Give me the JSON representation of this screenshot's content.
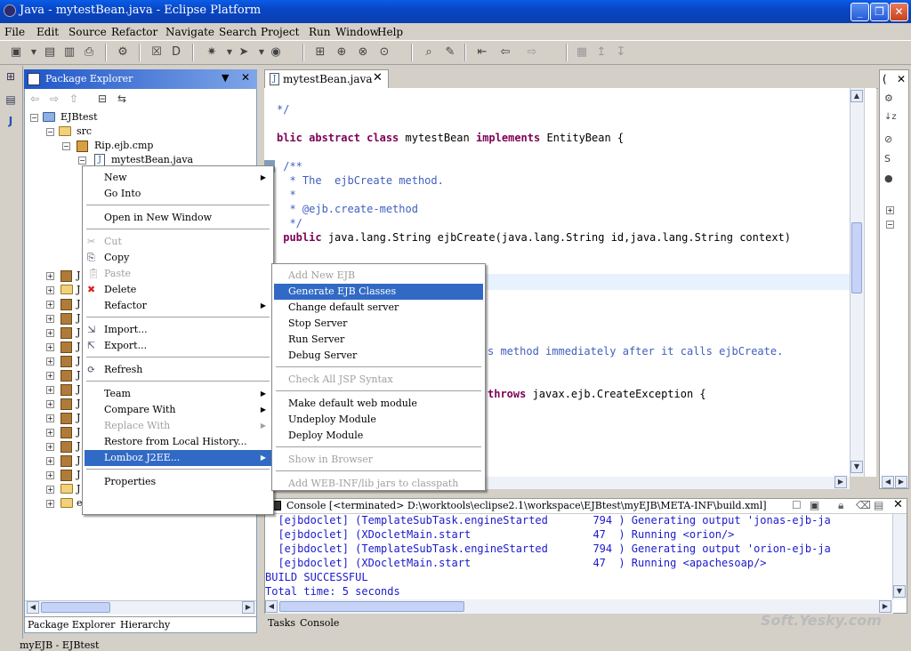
{
  "window": {
    "title": "Java - mytestBean.java - Eclipse Platform"
  },
  "menubar": [
    "File",
    "Edit",
    "Source",
    "Refactor",
    "Navigate",
    "Search",
    "Project",
    "Run",
    "Window",
    "Help"
  ],
  "package_explorer": {
    "title": "Package Explorer",
    "tree": [
      {
        "label": "EJBtest",
        "level": 0
      },
      {
        "label": "src",
        "level": 1
      },
      {
        "label": "Rip.ejb.cmp",
        "level": 2
      },
      {
        "label": "mytestBean.java",
        "level": 3
      }
    ],
    "stub_letters": [
      "J",
      "J",
      "J",
      "J",
      "J",
      "J",
      "J",
      "J",
      "J",
      "J",
      "J",
      "J",
      "J",
      "J",
      "J",
      "J",
      "e"
    ],
    "bottom_tabs": [
      "Package Explorer",
      "Hierarchy"
    ]
  },
  "editor": {
    "tab": "mytestBean.java",
    "lines": [
      {
        "text": "*/",
        "cls": "cm"
      },
      {
        "text": "blic abstract class mytestBean implements EntityBean {",
        "cls": "mixed"
      },
      {
        "text": " /**",
        "cls": "cm"
      },
      {
        "text": "  * The  ejbCreate method.",
        "cls": "cm"
      },
      {
        "text": "  *",
        "cls": "cm"
      },
      {
        "text": "  * @ejb.create-method",
        "cls": "cm"
      },
      {
        "text": "  */",
        "cls": "cm"
      },
      {
        "text": " public java.lang.String ejbCreate(java.lang.String id,java.lang.String context)",
        "cls": "mixed2"
      }
    ],
    "line_partial_1": "s method immediately after it calls ejbCreate.",
    "line_partial_2_kw": "throws",
    "line_partial_2_rest": " javax.ejb.CreateException {"
  },
  "context_menu": {
    "items": [
      {
        "label": "New",
        "submenu": true
      },
      {
        "label": "Go Into"
      },
      {
        "sep": true
      },
      {
        "label": "Open in New Window"
      },
      {
        "sep": true
      },
      {
        "label": "Cut",
        "disabled": true
      },
      {
        "label": "Copy"
      },
      {
        "label": "Paste",
        "disabled": true
      },
      {
        "label": "Delete"
      },
      {
        "label": "Refactor",
        "submenu": true
      },
      {
        "sep": true
      },
      {
        "label": "Import..."
      },
      {
        "label": "Export..."
      },
      {
        "sep": true
      },
      {
        "label": "Refresh"
      },
      {
        "sep": true
      },
      {
        "label": "Team",
        "submenu": true
      },
      {
        "label": "Compare With",
        "submenu": true
      },
      {
        "label": "Replace With",
        "submenu": true,
        "disabled": true
      },
      {
        "label": "Restore from Local History..."
      },
      {
        "label": "Lomboz J2EE...",
        "submenu": true,
        "selected": true
      },
      {
        "sep": true
      },
      {
        "label": "Properties"
      }
    ]
  },
  "submenu": {
    "items": [
      {
        "label": "Add New EJB",
        "disabled": true
      },
      {
        "label": "Generate EJB Classes",
        "selected": true
      },
      {
        "label": "Change default server"
      },
      {
        "label": "Stop Server"
      },
      {
        "label": "Run Server"
      },
      {
        "label": "Debug Server"
      },
      {
        "sep": true
      },
      {
        "label": "Check All JSP Syntax",
        "disabled": true
      },
      {
        "sep": true
      },
      {
        "label": "Make default web module"
      },
      {
        "label": "Undeploy Module"
      },
      {
        "label": "Deploy Module"
      },
      {
        "sep": true
      },
      {
        "label": "Show in Browser",
        "disabled": true
      },
      {
        "sep": true
      },
      {
        "label": "Add WEB-INF/lib jars to classpath",
        "disabled": true
      }
    ]
  },
  "console": {
    "title": "Console [<terminated> D:\\worktools\\eclipse2.1\\workspace\\EJBtest\\myEJB\\META-INF\\build.xml]",
    "lines": [
      "  [ejbdoclet] (TemplateSubTask.engineStarted       794 ) Generating output 'jonas-ejb-ja",
      "  [ejbdoclet] (XDocletMain.start                   47  ) Running <orion/>",
      "  [ejbdoclet] (TemplateSubTask.engineStarted       794 ) Generating output 'orion-ejb-ja",
      "  [ejbdoclet] (XDocletMain.start                   47  ) Running <apachesoap/>",
      "BUILD SUCCESSFUL",
      "Total time: 5 seconds"
    ],
    "bottom_tabs": [
      "Tasks",
      "Console"
    ]
  },
  "status_bar": {
    "text": "myEJB - EJBtest"
  },
  "watermark": "Soft.Yesky.com"
}
